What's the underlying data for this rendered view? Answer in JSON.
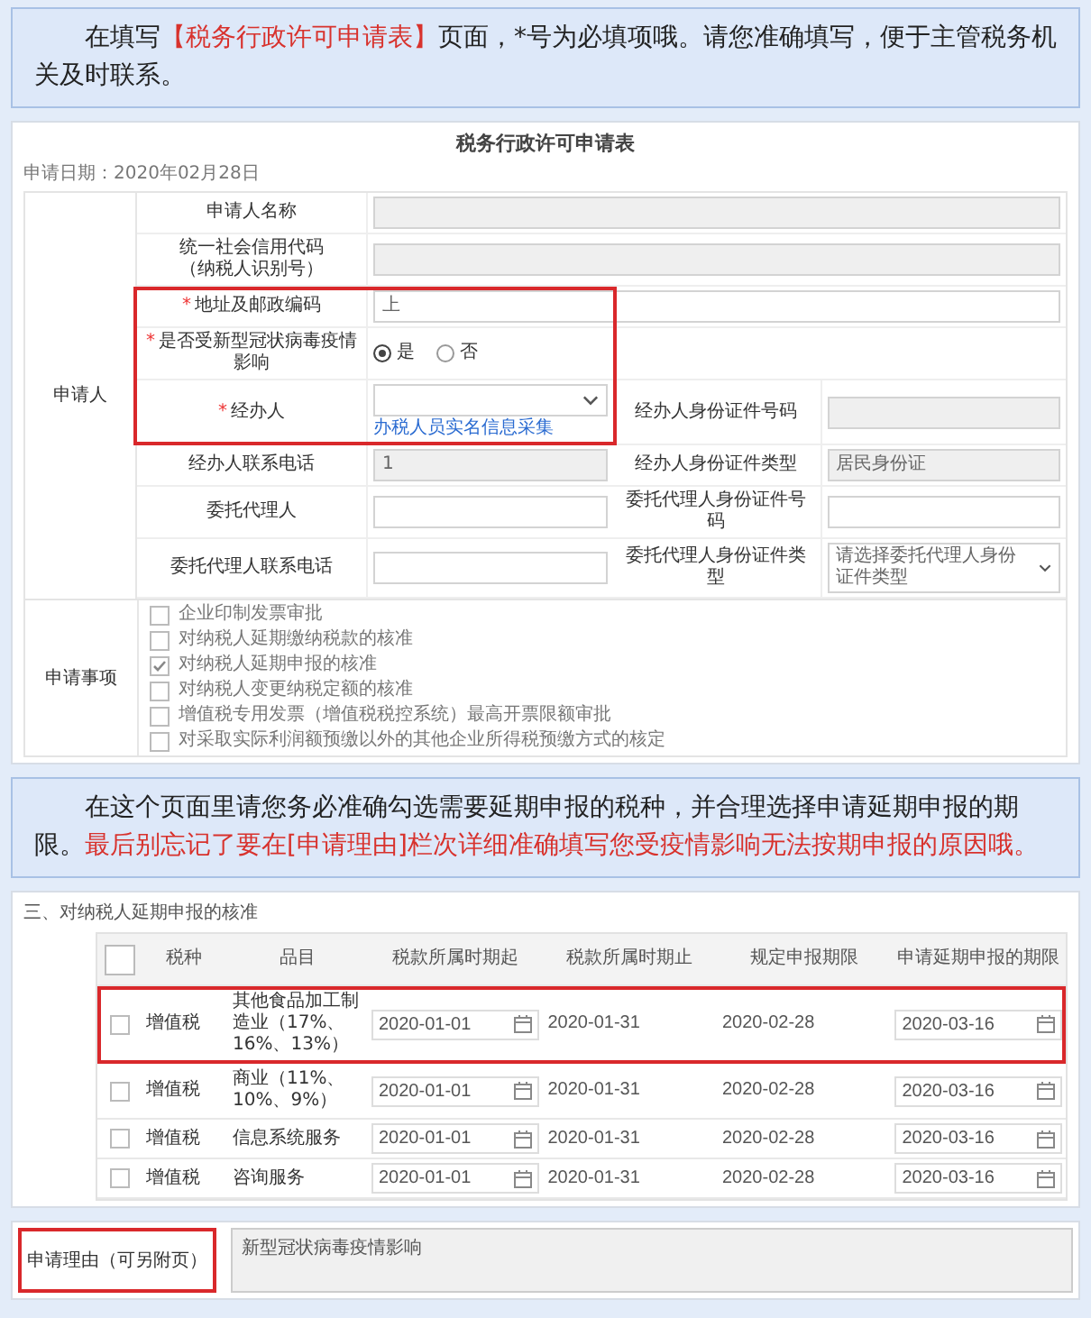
{
  "intro_note": {
    "segments": [
      {
        "text": "在填写",
        "emphasis": false
      },
      {
        "text": "【税务行政许可申请表】",
        "emphasis": true
      },
      {
        "text": "页面，*号为必填项哦。请您准确填写，便于主管税务机关及时联系。",
        "emphasis": false
      }
    ]
  },
  "permit_form": {
    "title": "税务行政许可申请表",
    "date": "申请日期：2020年02月28日",
    "applicant": {
      "label": "申请人",
      "rows": [
        {
          "label": "申请人名称",
          "kind": "text",
          "readonly": true,
          "highlighted": false
        },
        {
          "label": "统一社会信用代码",
          "note": "（纳税人识别号）",
          "kind": "text",
          "readonly": true,
          "highlighted": false
        },
        {
          "mark": "*",
          "label": "地址及邮政编码",
          "kind": "text",
          "value": "上",
          "readonly": false,
          "highlighted": true
        },
        {
          "mark": "*",
          "label": "是否受新型冠状病毒疫情影响",
          "kind": "radio",
          "highlighted": true,
          "options": [
            {
              "label": "是",
              "selected": true
            },
            {
              "label": "否",
              "selected": false
            }
          ]
        },
        {
          "mark": "*",
          "label": "经办人",
          "kind": "select",
          "link": "办税人员实名信息采集",
          "highlighted": true,
          "second": {
            "label": "经办人身份证件号码",
            "kind": "text",
            "readonly": true
          }
        },
        {
          "label": "经办人联系电话",
          "kind": "text",
          "value": "1",
          "readonly": true,
          "highlighted": false,
          "second": {
            "label": "经办人身份证件类型",
            "kind": "text",
            "value": "居民身份证",
            "readonly": true
          }
        },
        {
          "label": "委托代理人",
          "kind": "text",
          "readonly": false,
          "highlighted": false,
          "second": {
            "label": "委托代理人身份证件号码",
            "kind": "text",
            "readonly": false
          }
        },
        {
          "label": "委托代理人联系电话",
          "kind": "text",
          "readonly": false,
          "highlighted": false,
          "second": {
            "label": "委托代理人身份证件类型",
            "kind": "select",
            "placeholder": "请选择委托代理人身份证件类型"
          }
        }
      ]
    },
    "matters": {
      "label": "申请事项",
      "items": [
        {
          "label": "企业印制发票审批",
          "checked": false
        },
        {
          "label": "对纳税人延期缴纳税款的核准",
          "checked": false
        },
        {
          "label": "对纳税人延期申报的核准",
          "checked": true
        },
        {
          "label": "对纳税人变更纳税定额的核准",
          "checked": false
        },
        {
          "label": "增值税专用发票（增值税税控系统）最高开票限额审批",
          "checked": false
        },
        {
          "label": "对采取实际利润额预缴以外的其他企业所得税预缴方式的核定",
          "checked": false
        }
      ]
    }
  },
  "table_note": {
    "segments": [
      {
        "text": "在这个页面里请您务必准确勾选需要延期申报的税种，并合理选择申请延期申报的期限。",
        "emphasis": false
      },
      {
        "text": "最后别忘记了要在[申请理由]栏次详细准确填写您受疫情影响无法按期申报的原因哦。",
        "emphasis": true
      }
    ]
  },
  "deferral": {
    "heading": "三、对纳税人延期申报的核准",
    "header_checked": false,
    "columns": [
      "税种",
      "品目",
      "税款所属时期起",
      "税款所属时期止",
      "规定申报期限",
      "申请延期申报的期限"
    ],
    "rows": [
      {
        "checked": false,
        "highlighted": true,
        "tax": "增值税",
        "item": "其他食品加工制造业（17%、16%、13%）",
        "period_start": "2020-01-01",
        "period_end": "2020-01-31",
        "due": "2020-02-28",
        "extended": "2020-03-16"
      },
      {
        "checked": false,
        "highlighted": false,
        "tax": "增值税",
        "item": "商业（11%、10%、9%）",
        "period_start": "2020-01-01",
        "period_end": "2020-01-31",
        "due": "2020-02-28",
        "extended": "2020-03-16"
      },
      {
        "checked": false,
        "highlighted": false,
        "tax": "增值税",
        "item": "信息系统服务",
        "period_start": "2020-01-01",
        "period_end": "2020-01-31",
        "due": "2020-02-28",
        "extended": "2020-03-16"
      },
      {
        "checked": false,
        "highlighted": false,
        "tax": "增值税",
        "item": "咨询服务",
        "period_start": "2020-01-01",
        "period_end": "2020-01-31",
        "due": "2020-02-28",
        "extended": "2020-03-16"
      }
    ]
  },
  "reason": {
    "label": "申请理由（可另附页）",
    "highlighted": true,
    "value": "新型冠状病毒疫情影响"
  }
}
